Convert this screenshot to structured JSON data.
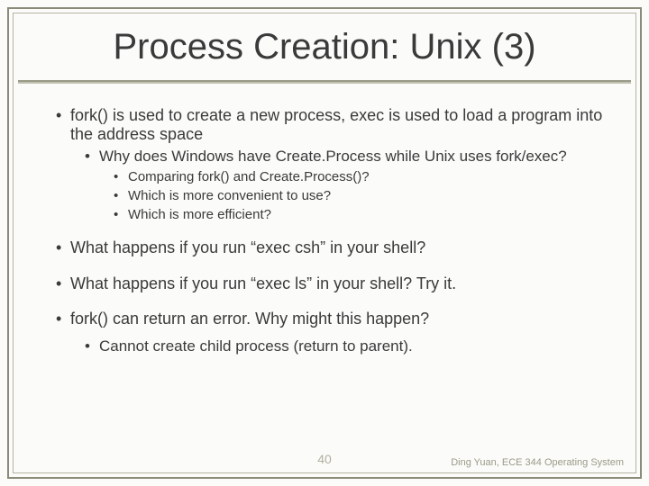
{
  "title": "Process Creation: Unix (3)",
  "bullets": {
    "b1": "fork() is used to create a new process, exec is used to load a program into the address space",
    "b1a": "Why does Windows have Create.Process while Unix uses fork/exec?",
    "b1a1": "Comparing fork() and Create.Process()?",
    "b1a2": "Which is more convenient to use?",
    "b1a3": "Which is more efficient?",
    "b2": "What happens if you run “exec csh” in your shell?",
    "b3": "What happens if you run “exec ls” in your shell? Try it.",
    "b4": "fork() can return an error.  Why might this happen?",
    "b4a": "Cannot create child process (return to parent)."
  },
  "page_number": "40",
  "footer": "Ding Yuan, ECE 344 Operating System"
}
